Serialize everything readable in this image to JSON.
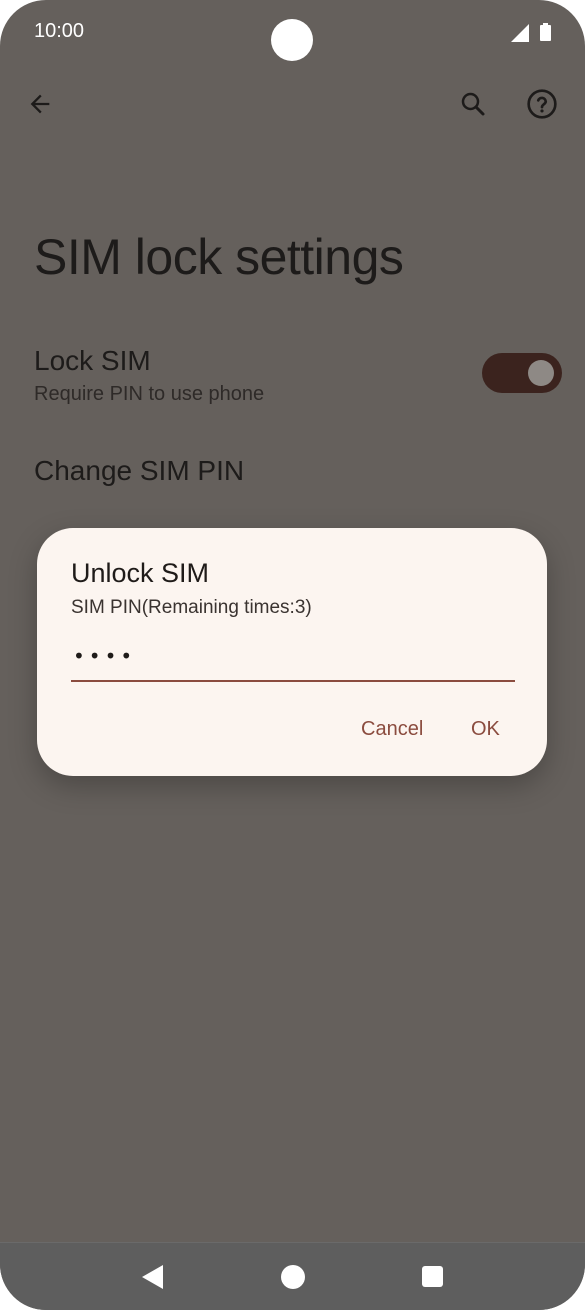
{
  "status_bar": {
    "time": "10:00",
    "icons": [
      "signal-icon",
      "battery-icon"
    ]
  },
  "toolbar": {
    "back_icon": "back-arrow-icon",
    "search_icon": "search-icon",
    "help_icon": "help-icon"
  },
  "page": {
    "title": "SIM lock settings",
    "lock_sim": {
      "title": "Lock SIM",
      "subtitle": "Require PIN to use phone",
      "enabled": true
    },
    "change_pin": {
      "title": "Change SIM PIN"
    }
  },
  "dialog": {
    "title": "Unlock SIM",
    "message": "SIM PIN(Remaining times:3)",
    "pin_value": "••••",
    "cancel_label": "Cancel",
    "ok_label": "OK"
  },
  "colors": {
    "scrim_background": "#65605c",
    "dialog_background": "#fcf5f0",
    "accent": "#8b4c3f",
    "toggle_track": "#3b231e"
  },
  "nav_bar": {
    "icons": [
      "nav-back-icon",
      "nav-home-icon",
      "nav-recents-icon"
    ]
  }
}
